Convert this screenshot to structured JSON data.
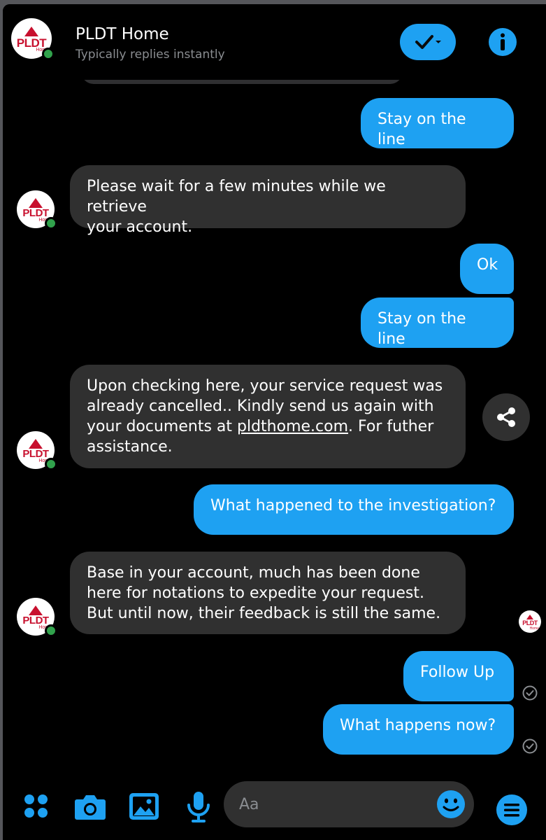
{
  "colors": {
    "accent": "#1ea1f2",
    "incoming_bubble": "#303030",
    "online": "#31a24c",
    "brand_red": "#c8102e"
  },
  "header": {
    "contact_name": "PLDT Home",
    "status": "Typically replies instantly",
    "avatar_logo": "PLDT",
    "avatar_logo_sub": "Home"
  },
  "messages": [
    {
      "id": "m1",
      "direction": "outgoing",
      "text": "Stay on the line"
    },
    {
      "id": "m2",
      "direction": "incoming",
      "text": "Please wait for a few minutes while we retrieve\nyour account."
    },
    {
      "id": "m3",
      "direction": "outgoing",
      "text": "Ok"
    },
    {
      "id": "m4",
      "direction": "outgoing",
      "text": "Stay on the line"
    },
    {
      "id": "m5",
      "direction": "incoming",
      "text_before_link": "Upon checking here, your service request was\nalready cancelled.. Kindly send us again with\nyour documents at ",
      "link": "pldthome.com",
      "text_after_link": ". For futher\nassistance."
    },
    {
      "id": "m6",
      "direction": "outgoing",
      "text": "What happened to the investigation?"
    },
    {
      "id": "m7",
      "direction": "incoming",
      "text": "Base in your account, much has been done\nhere for notations to expedite your request.\nBut until now, their feedback is still the same."
    },
    {
      "id": "m8",
      "direction": "outgoing",
      "text": "Follow Up",
      "status_icon": "delivered-check-icon"
    },
    {
      "id": "m9",
      "direction": "outgoing",
      "text": "What happens now?",
      "status_icon": "delivered-check-icon"
    }
  ],
  "composer": {
    "placeholder": "Aa",
    "icons": [
      "apps-grid-icon",
      "camera-icon",
      "gallery-icon",
      "microphone-icon",
      "emoji-icon",
      "menu-icon"
    ]
  }
}
